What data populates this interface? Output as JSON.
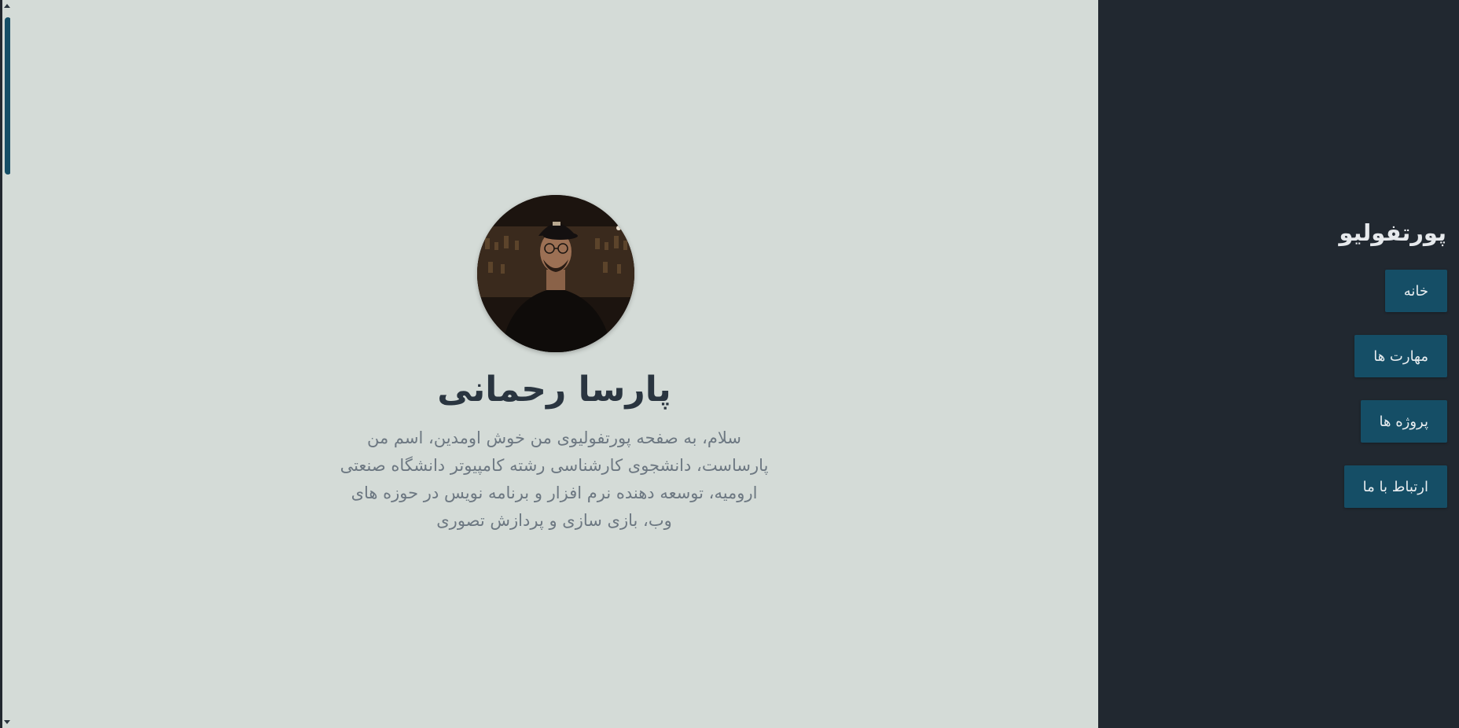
{
  "sidebar": {
    "brand": "پورتفولیو",
    "nav": [
      {
        "label": "خانه"
      },
      {
        "label": "مهارت ها"
      },
      {
        "label": "پروژه ها"
      },
      {
        "label": "ارتباط با ما"
      }
    ]
  },
  "hero": {
    "name": "پارسا رحمانی",
    "bio": "سلام، به صفحه پورتفولیوی من خوش اومدین، اسم من پارساست، دانشجوی کارشناسی رشته کامپیوتر دانشگاه صنعتی ارومیه، توسعه دهنده نرم افزار و برنامه نویس در حوزه های وب، بازی سازی و پردازش تصوری"
  },
  "colors": {
    "background": "#d4dbd7",
    "sidebar": "#212830",
    "accent": "#154e66",
    "name_text": "#2a3540",
    "bio_text": "#6d7882"
  }
}
